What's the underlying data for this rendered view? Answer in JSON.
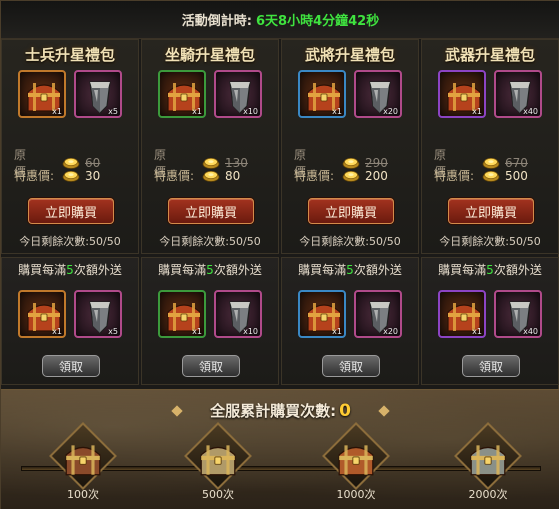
{
  "countdown": {
    "label": "活動倒計時:",
    "value": "6天8小時4分鐘42秒"
  },
  "packages": [
    {
      "title": "士兵升星禮包",
      "chest_qty": "x1",
      "item_qty": "x5",
      "original_label": "原　價:",
      "original_price": "60",
      "sale_label": "特惠價:",
      "sale_price": "30",
      "buy_label": "立即購買",
      "remaining": "今日剩餘次數:50/50",
      "rarity_color": "#c0792b"
    },
    {
      "title": "坐騎升星禮包",
      "chest_qty": "x1",
      "item_qty": "x10",
      "original_label": "原　價:",
      "original_price": "130",
      "sale_label": "特惠價:",
      "sale_price": "80",
      "buy_label": "立即購買",
      "remaining": "今日剩餘次數:50/50",
      "rarity_color": "#3c9a3c"
    },
    {
      "title": "武將升星禮包",
      "chest_qty": "x1",
      "item_qty": "x20",
      "original_label": "原　價:",
      "original_price": "290",
      "sale_label": "特惠價:",
      "sale_price": "200",
      "buy_label": "立即購買",
      "remaining": "今日剩餘次數:50/50",
      "rarity_color": "#3a88c4"
    },
    {
      "title": "武器升星禮包",
      "chest_qty": "x1",
      "item_qty": "x40",
      "original_label": "原　價:",
      "original_price": "670",
      "sale_label": "特惠價:",
      "sale_price": "500",
      "buy_label": "立即購買",
      "remaining": "今日剩餘次數:50/50",
      "rarity_color": "#8c44c4"
    }
  ],
  "bonus": [
    {
      "pre": "購買每滿",
      "n": "5",
      "post": "次額外送",
      "chest_qty": "x1",
      "item_qty": "x5",
      "claim_label": "領取"
    },
    {
      "pre": "購買每滿",
      "n": "5",
      "post": "次額外送",
      "chest_qty": "x1",
      "item_qty": "x10",
      "claim_label": "領取"
    },
    {
      "pre": "購買每滿",
      "n": "5",
      "post": "次額外送",
      "chest_qty": "x1",
      "item_qty": "x20",
      "claim_label": "領取"
    },
    {
      "pre": "購買每滿",
      "n": "5",
      "post": "次額外送",
      "chest_qty": "x1",
      "item_qty": "x40",
      "claim_label": "領取"
    }
  ],
  "server_total": {
    "label": "全服累計購買次數:",
    "value": "0"
  },
  "milestones": [
    {
      "label": "100次",
      "icon": "wooden-chest-icon",
      "color": "#8a4a2a"
    },
    {
      "label": "500次",
      "icon": "silver-chest-icon",
      "color": "#b09a68"
    },
    {
      "label": "1000次",
      "icon": "bronze-chest-icon",
      "color": "#b05a2a"
    },
    {
      "label": "2000次",
      "icon": "steel-chest-icon",
      "color": "#8a9088"
    }
  ]
}
